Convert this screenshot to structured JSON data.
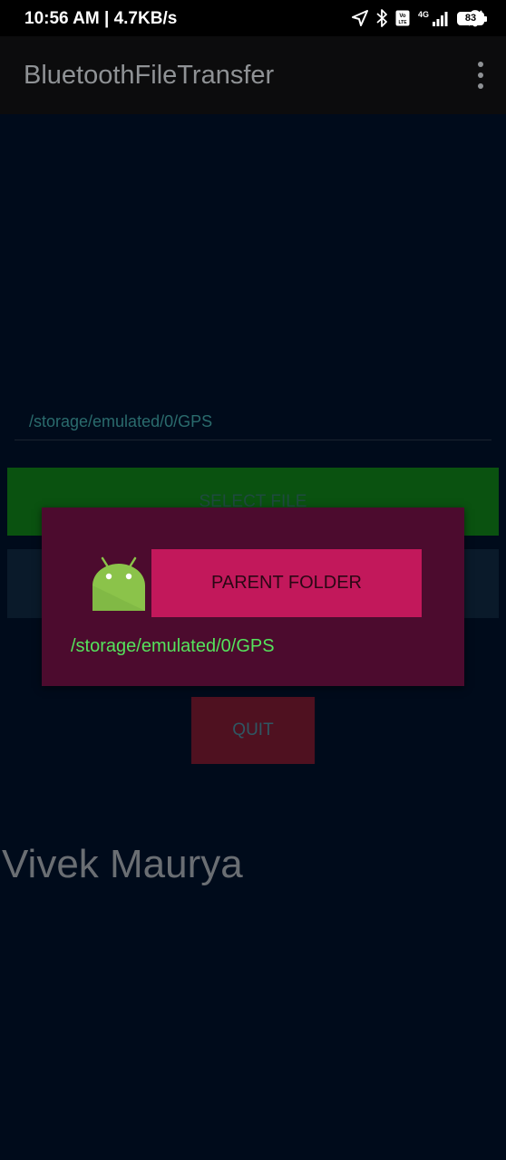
{
  "status_bar": {
    "time": "10:56 AM | 4.7KB/s",
    "battery": "83",
    "network": "4G"
  },
  "app_bar": {
    "title": "BluetoothFileTransfer"
  },
  "main": {
    "path_display": "/storage/emulated/0/GPS",
    "select_file_label": "SELECT FILE",
    "quit_label": "QUIT",
    "author_name": "Vivek Maurya"
  },
  "dialog": {
    "parent_folder_label": "PARENT FOLDER",
    "current_path": "/storage/emulated/0/GPS"
  },
  "colors": {
    "background": "#000b1b",
    "select_button": "#0a5210",
    "quit_button": "#4f1120",
    "dialog_background": "#4c0b2e",
    "parent_button": "#c2185b",
    "dialog_path_text": "#55e35c",
    "android_icon": "#8bc34a"
  }
}
